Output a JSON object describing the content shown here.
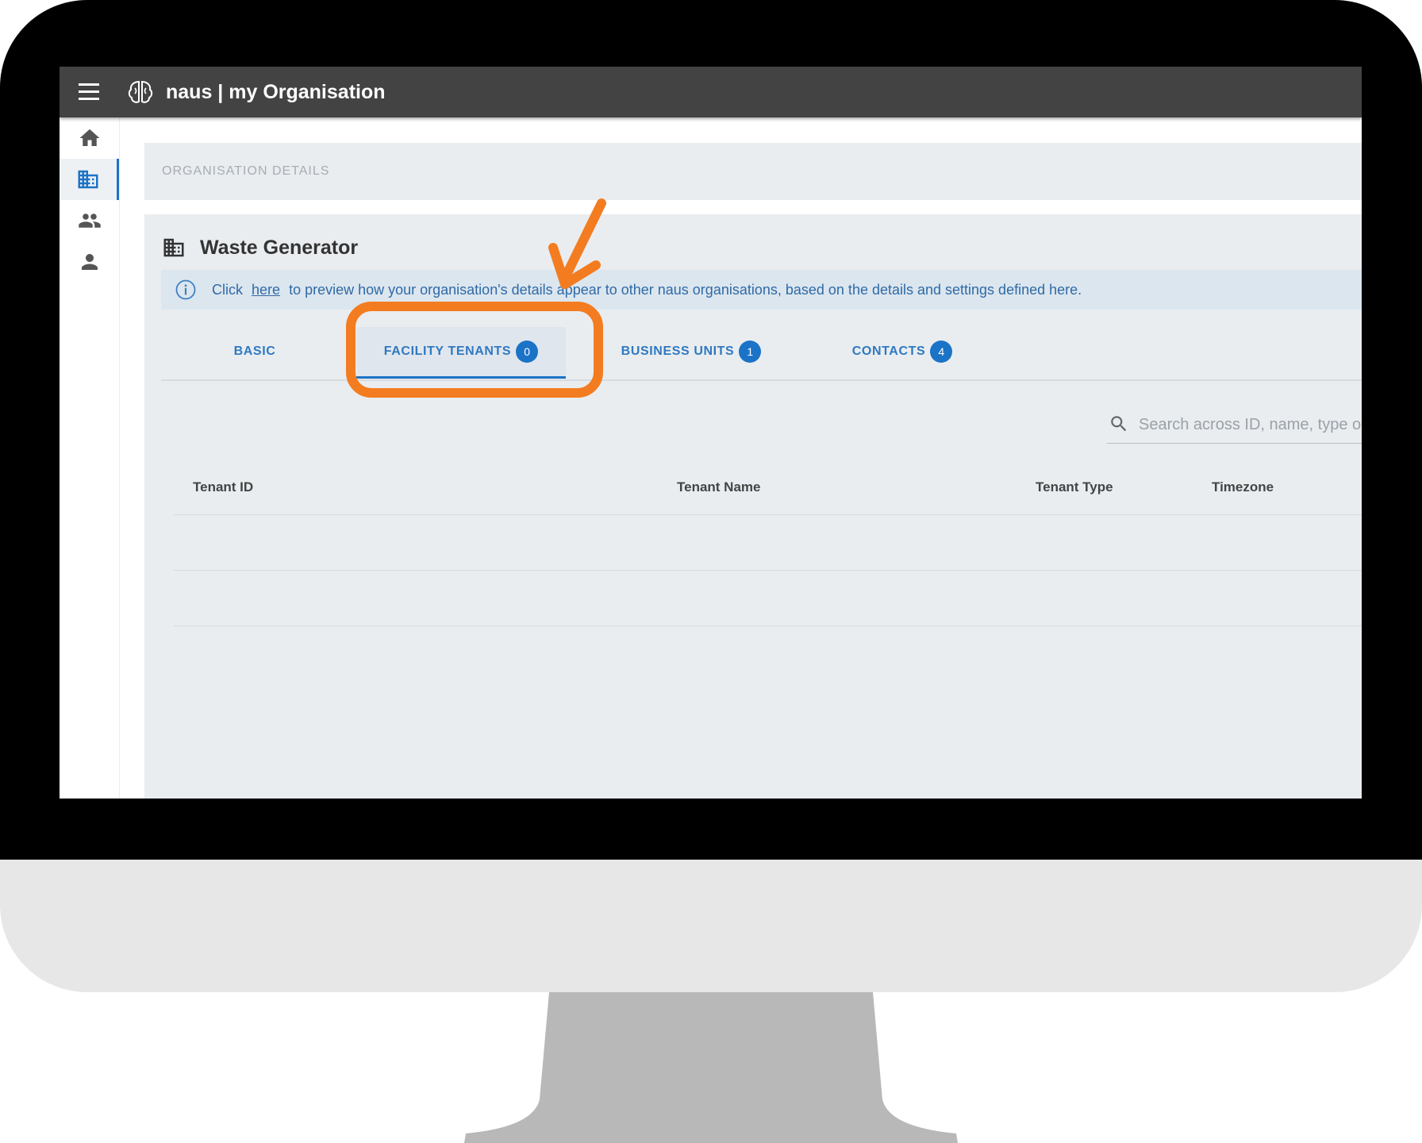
{
  "app": {
    "title": "naus | my Organisation"
  },
  "breadcrumb": "ORGANISATION DETAILS",
  "organisation": {
    "name": "Waste Generator"
  },
  "info_banner": {
    "prefix": "Click",
    "link_text": "here",
    "suffix": "to preview how your organisation's details appear to other naus organisations, based on the details and settings defined here."
  },
  "tabs": [
    {
      "label": "BASIC",
      "badge": null,
      "active": false
    },
    {
      "label": "FACILITY TENANTS",
      "badge": "0",
      "active": true
    },
    {
      "label": "BUSINESS UNITS",
      "badge": "1",
      "active": false
    },
    {
      "label": "CONTACTS",
      "badge": "4",
      "active": false
    }
  ],
  "search": {
    "placeholder": "Search across ID, name, type or timezone",
    "value": ""
  },
  "table": {
    "columns": [
      "Tenant ID",
      "Tenant Name",
      "Tenant Type",
      "Timezone"
    ],
    "rows": []
  },
  "colors": {
    "topbar": "#434343",
    "accent": "#1a73c6",
    "annotation": "#f47c20",
    "panel": "#e9edf0"
  },
  "icons": {
    "menu": "menu-icon",
    "logo": "brain-logo-icon",
    "home": "home-icon",
    "organisation": "building-icon",
    "users": "group-icon",
    "profile": "person-icon",
    "info": "info-icon",
    "search": "search-icon"
  }
}
